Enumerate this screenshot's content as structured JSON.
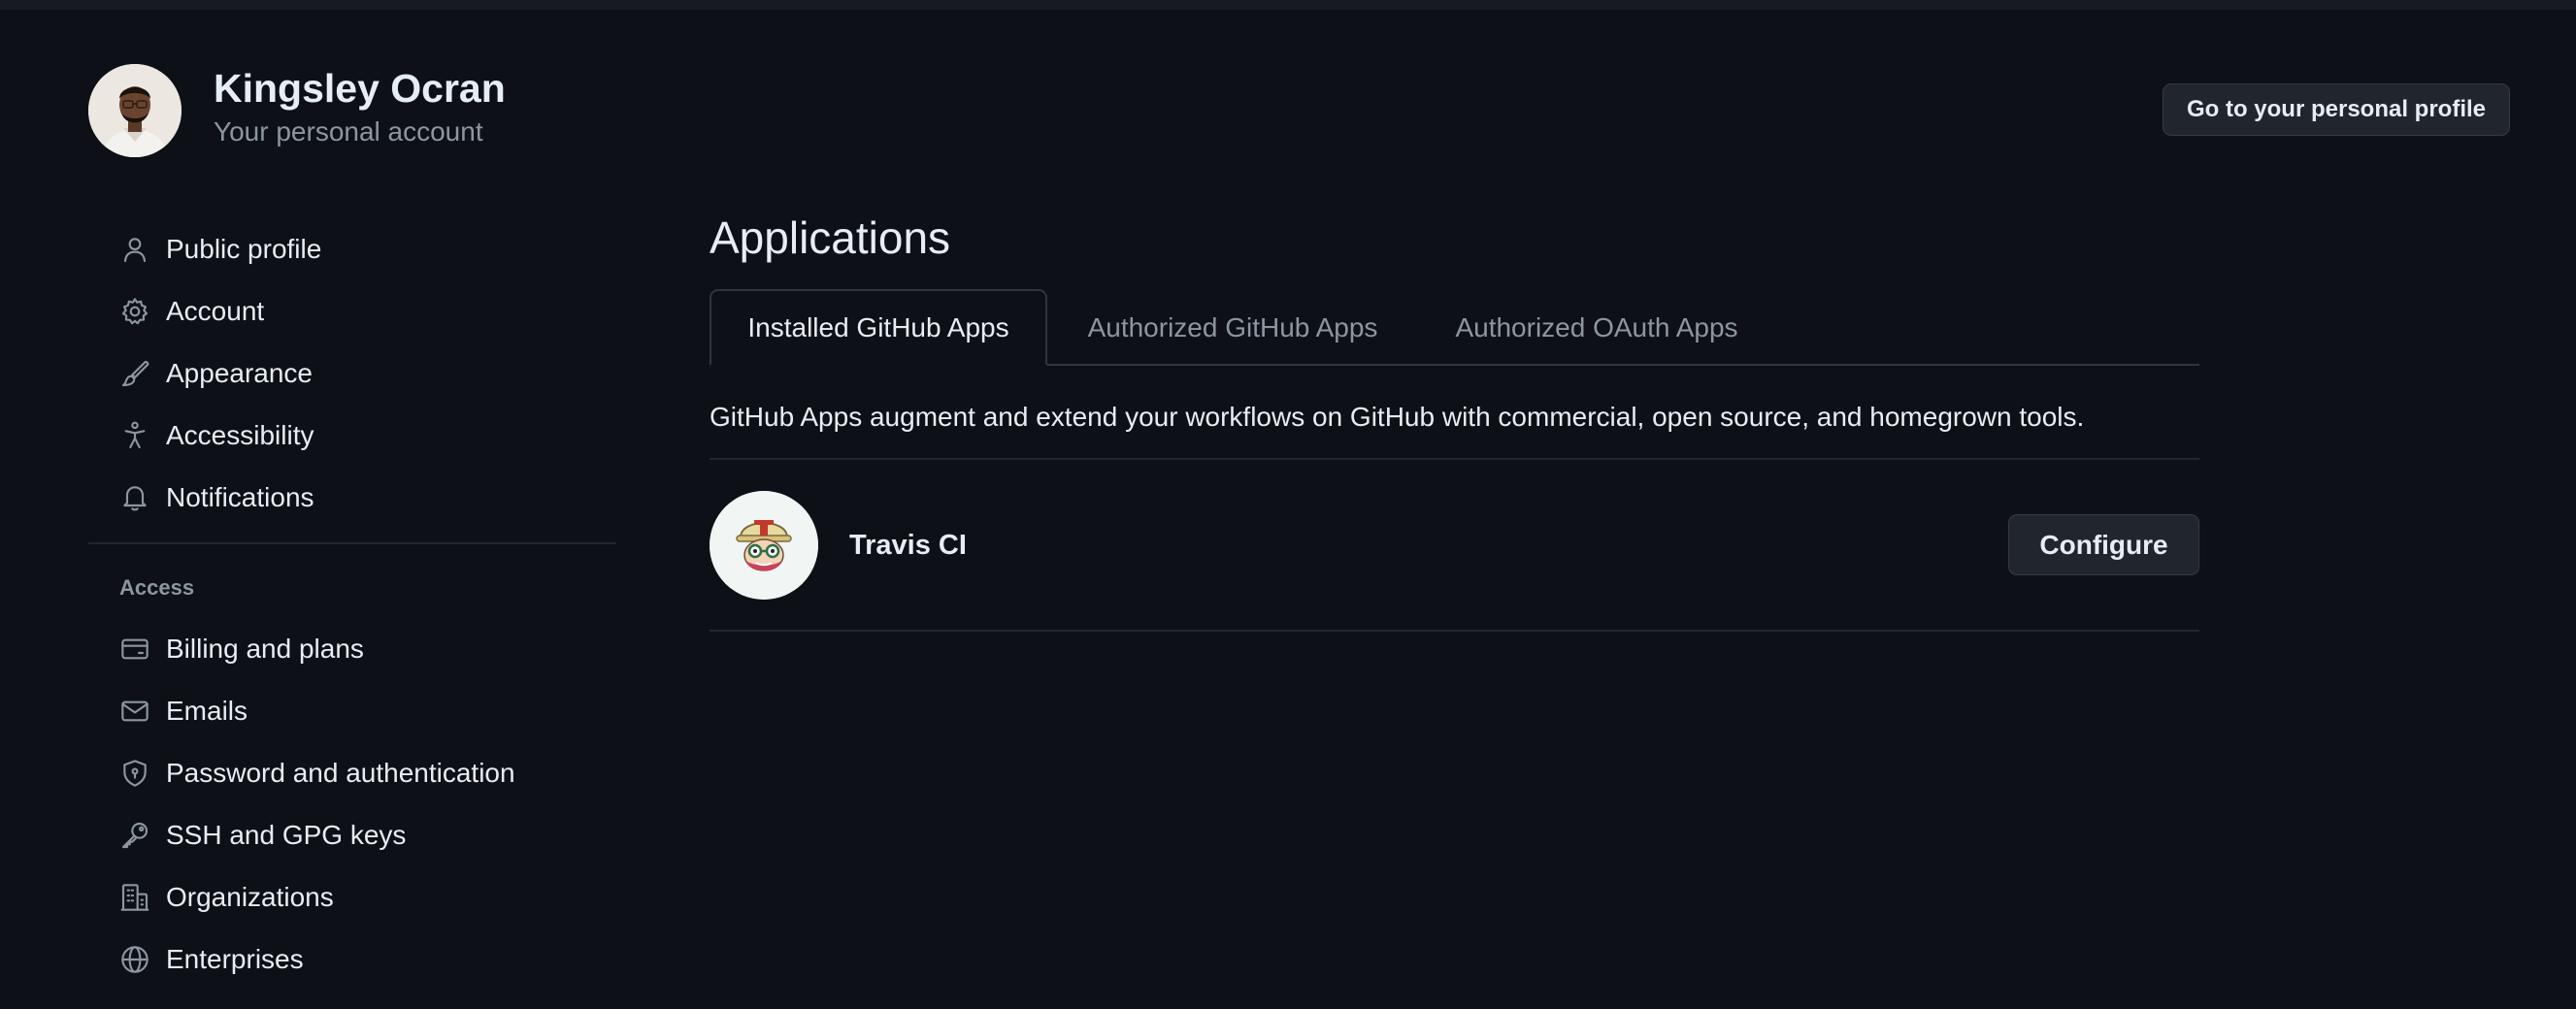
{
  "account": {
    "name": "Kingsley Ocran",
    "subtitle": "Your personal account",
    "profile_button": "Go to your personal profile"
  },
  "sidebar": {
    "items": [
      {
        "label": "Public profile",
        "icon": "person-icon"
      },
      {
        "label": "Account",
        "icon": "gear-icon"
      },
      {
        "label": "Appearance",
        "icon": "paintbrush-icon"
      },
      {
        "label": "Accessibility",
        "icon": "accessibility-icon"
      },
      {
        "label": "Notifications",
        "icon": "bell-icon"
      }
    ],
    "access_label": "Access",
    "access_items": [
      {
        "label": "Billing and plans",
        "icon": "credit-card-icon"
      },
      {
        "label": "Emails",
        "icon": "mail-icon"
      },
      {
        "label": "Password and authentication",
        "icon": "shield-lock-icon"
      },
      {
        "label": "SSH and GPG keys",
        "icon": "key-icon"
      },
      {
        "label": "Organizations",
        "icon": "organization-icon"
      },
      {
        "label": "Enterprises",
        "icon": "globe-icon"
      }
    ]
  },
  "main": {
    "title": "Applications",
    "tabs": [
      {
        "label": "Installed GitHub Apps",
        "active": true
      },
      {
        "label": "Authorized GitHub Apps",
        "active": false
      },
      {
        "label": "Authorized OAuth Apps",
        "active": false
      }
    ],
    "description": "GitHub Apps augment and extend your workflows on GitHub with commercial, open source, and homegrown tools.",
    "apps": [
      {
        "name": "Travis CI",
        "action": "Configure",
        "logo": "travis-ci-mascot"
      }
    ]
  },
  "colors": {
    "background": "#0d1117",
    "text": "#e6edf3",
    "muted": "#8d96a0",
    "border": "#30363d",
    "button_bg": "#21262d"
  }
}
